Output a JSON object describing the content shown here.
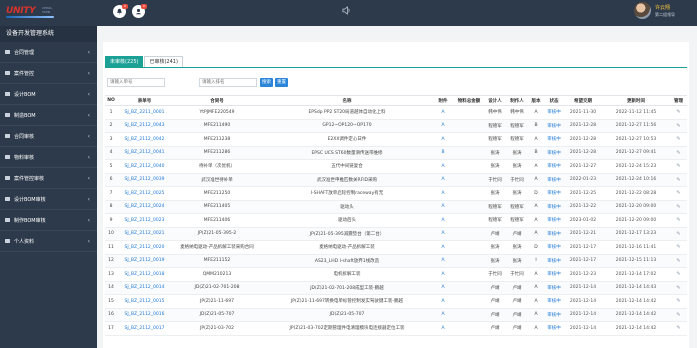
{
  "logo": {
    "brand": "UNITY",
    "brand_small": "CHINA-VSPN"
  },
  "sidebar": {
    "system_title": "设备开发管理系统",
    "items": [
      {
        "label": "合同管理",
        "icon": "file-icon"
      },
      {
        "label": "案件管控",
        "icon": "folder-icon"
      },
      {
        "label": "设计BOM",
        "icon": "folder-icon"
      },
      {
        "label": "制造BOM",
        "icon": "folder-icon"
      },
      {
        "label": "合同审核",
        "icon": "folder-icon"
      },
      {
        "label": "物料审核",
        "icon": "folder-icon"
      },
      {
        "label": "案件管控审核",
        "icon": "folder-icon"
      },
      {
        "label": "设计BOM审核",
        "icon": "folder-icon"
      },
      {
        "label": "制作BOM审核",
        "icon": "folder-icon"
      },
      {
        "label": "个人资料",
        "icon": "folder-icon"
      }
    ]
  },
  "topbar": {
    "notify_badge": "0",
    "message_badge": "0",
    "user_name": "许云翔",
    "user_role": "第二组领导"
  },
  "tabs": [
    {
      "label": "未审核(225)",
      "active": true
    },
    {
      "label": "已审核(241)",
      "active": false
    }
  ],
  "search": {
    "order_placeholder": "请输入单号",
    "name_placeholder": "请输入排名",
    "search_label": "搜索",
    "reset_label": "重置"
  },
  "table": {
    "columns": [
      "NO",
      "表单号",
      "合同号",
      "名称",
      "附件",
      "物料总金额",
      "设计人",
      "制作人",
      "版本",
      "状态",
      "希望交期",
      "更新时间",
      "管理"
    ],
    "rows": [
      [
        "1",
        "SJ_BZ_2211_0001",
        "YtPJMFE220549",
        "EPSdp PP2 ST20局道越体自动化上料",
        "A",
        "",
        "韩中伟",
        "韩中伟",
        "A",
        "审核中",
        "2021-11-30",
        "2022-11-12 11:45",
        "✎"
      ],
      [
        "2",
        "SJ_BZ_2112_0043",
        "MFE211490",
        "GP12~OP120~OP170",
        "A",
        "",
        "程德军",
        "程德军",
        "B",
        "审核中",
        "2021-12-28",
        "2021-12-27 11:56",
        "✎"
      ],
      [
        "3",
        "SJ_BZ_2112_0042",
        "MFE211238",
        "E2XX调件定心日件",
        "A",
        "",
        "程德军",
        "程德军",
        "A",
        "审核中",
        "2021-12-28",
        "2021-12-27 10:53",
        "✎"
      ],
      [
        "4",
        "SJ_BZ_2112_0041",
        "MFE211286",
        "EPSC UCS ST60数量滑传送带维修",
        "B",
        "",
        "张涛",
        "张涛",
        "B",
        "审核中",
        "2021-12-28",
        "2021-12-27 09:41",
        "✎"
      ],
      [
        "5",
        "SJ_BZ_2112_0040",
        "待补单（次优机）",
        "五代中间链复合",
        "A",
        "",
        "张涛",
        "张涛",
        "A",
        "审核中",
        "2021-12-27",
        "2021-12-24 15:23",
        "✎"
      ],
      [
        "6",
        "SJ_BZ_2112_0039",
        "武汉准世待补单",
        "武汉准世申推匹数关RFID采购",
        "A",
        "",
        "于忙同",
        "于忙同",
        "A",
        "审核中",
        "2022-01-23",
        "2021-12-24 10:16",
        "✎"
      ],
      [
        "7",
        "SJ_BZ_2112_0025",
        "MFE211250",
        "I-SHAFT放单启轮控制raceway有无",
        "A",
        "",
        "张涛",
        "张涛",
        "D",
        "审核中",
        "2021-12-25",
        "2021-12-22 08:28",
        "✎"
      ],
      [
        "8",
        "SJ_BZ_2112_0024",
        "MFE211405",
        "驱动头",
        "A",
        "",
        "程德军",
        "程德军",
        "A",
        "审核中",
        "2021-12-22",
        "2021-12-20 09:00",
        "✎"
      ],
      [
        "9",
        "SJ_BZ_2112_0023",
        "MFE211406",
        "驱动后头",
        "A",
        "",
        "程德军",
        "程德军",
        "A",
        "审核中",
        "2023-01-02",
        "2021-12-20 09:00",
        "✎"
      ],
      [
        "10",
        "SJ_BZ_2112_0021",
        "JP(Z)21-05-395-2",
        "JP(Z)21-05-395减震垫台（第二台）",
        "A",
        "",
        "卢靖",
        "卢靖",
        "A",
        "审核中",
        "2021-12-21",
        "2021-12-17 13:23",
        "✎"
      ],
      [
        "11",
        "SJ_BZ_2112_0020",
        "麦格纳电驱动-产品拆解工装采购合同",
        "麦格纳电驱动-产品拆解工装",
        "A",
        "",
        "张涛",
        "张涛",
        "D",
        "审核中",
        "2021-12-17",
        "2021-12-16 11:41",
        "✎"
      ],
      [
        "12",
        "SJ_BZ_2112_0019",
        "MFE211152",
        "AS23_LHD I-shaft放弃1线改造",
        "A",
        "",
        "张涛",
        "张涛",
        "I",
        "审核中",
        "2021-12-17",
        "2021-12-15 11:13",
        "✎"
      ],
      [
        "13",
        "SJ_BZ_2112_0018",
        "QMM210213",
        "电机拆解工装",
        "A",
        "",
        "于忙同",
        "于忙同",
        "A",
        "审核中",
        "2021-12-23",
        "2021-12-14 17:02",
        "✎"
      ],
      [
        "14",
        "SJ_BZ_2112_0014",
        "JD(Z)21-02-701-208",
        "JD(Z)21-02-701-208成型工装-鹏越",
        "A",
        "",
        "卢靖",
        "卢靖",
        "A",
        "审核中",
        "2021-12-14",
        "2021-12-14 14:43",
        "✎"
      ],
      [
        "15",
        "SJ_BZ_2112_0015",
        "JP(Z)21-11-697",
        "JP(Z)21-11-697转换电单标管控制发实驾驶键工装-鹏越",
        "A",
        "",
        "卢靖",
        "卢靖",
        "A",
        "审核中",
        "2021-12-14",
        "2021-12-14 14:42",
        "✎"
      ],
      [
        "16",
        "SJ_BZ_2112_0016",
        "JD(Z)21-05-707",
        "JD(Z)21-05-707",
        "A",
        "",
        "卢靖",
        "卢靖",
        "A",
        "审核中",
        "2021-12-14",
        "2021-12-14 14:42",
        "✎"
      ],
      [
        "17",
        "SJ_BZ_2112_0017",
        "JP(Z)21-03-702",
        "JP(Z)21-03-702定期管理件电清理模块电连接器定位工装",
        "A",
        "",
        "卢靖",
        "卢靖",
        "A",
        "审核中",
        "2021-12-14",
        "2021-12-14 14:42",
        "✎"
      ]
    ]
  },
  "colors": {
    "accent": "#1aa094",
    "link": "#1e78d6",
    "sidebar_bg": "#2d3a4b"
  }
}
